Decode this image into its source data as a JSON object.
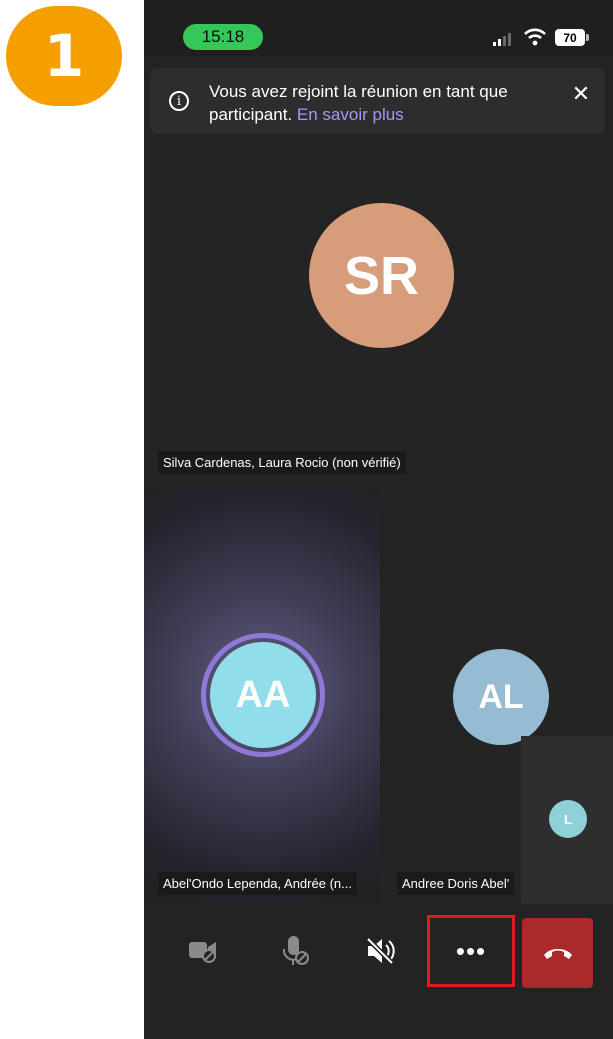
{
  "step_badge": {
    "number": "1",
    "color": "#f5a000"
  },
  "status_bar": {
    "time": "15:18",
    "battery": "70",
    "icons": [
      "signal-icon",
      "wifi-icon",
      "battery-icon"
    ]
  },
  "notice": {
    "text": "Vous avez rejoint la réunion en tant que participant.",
    "link": "En savoir plus",
    "info_icon": "info-icon",
    "close_icon": "close-icon"
  },
  "participants": [
    {
      "initials": "SR",
      "name": "Silva Cardenas, Laura Rocio (non vérifié)",
      "color": "#d79c7a"
    },
    {
      "initials": "AA",
      "name": "Abel'Ondo Lependa, Andrée (n...",
      "color": "#91deea",
      "speaking": true
    },
    {
      "initials": "AL",
      "name": "Andree Doris Abel'",
      "color": "#95bcd3"
    }
  ],
  "self_view": {
    "initials": "L",
    "color": "#8fd1d8"
  },
  "toolbar": {
    "camera": "camera-off-icon",
    "mic": "mic-off-icon",
    "speaker": "speaker-muted-icon",
    "more": "•••",
    "hangup": "hang-up-icon",
    "hangup_color": "#aa2a2a",
    "highlight_color": "#e01b1b"
  }
}
